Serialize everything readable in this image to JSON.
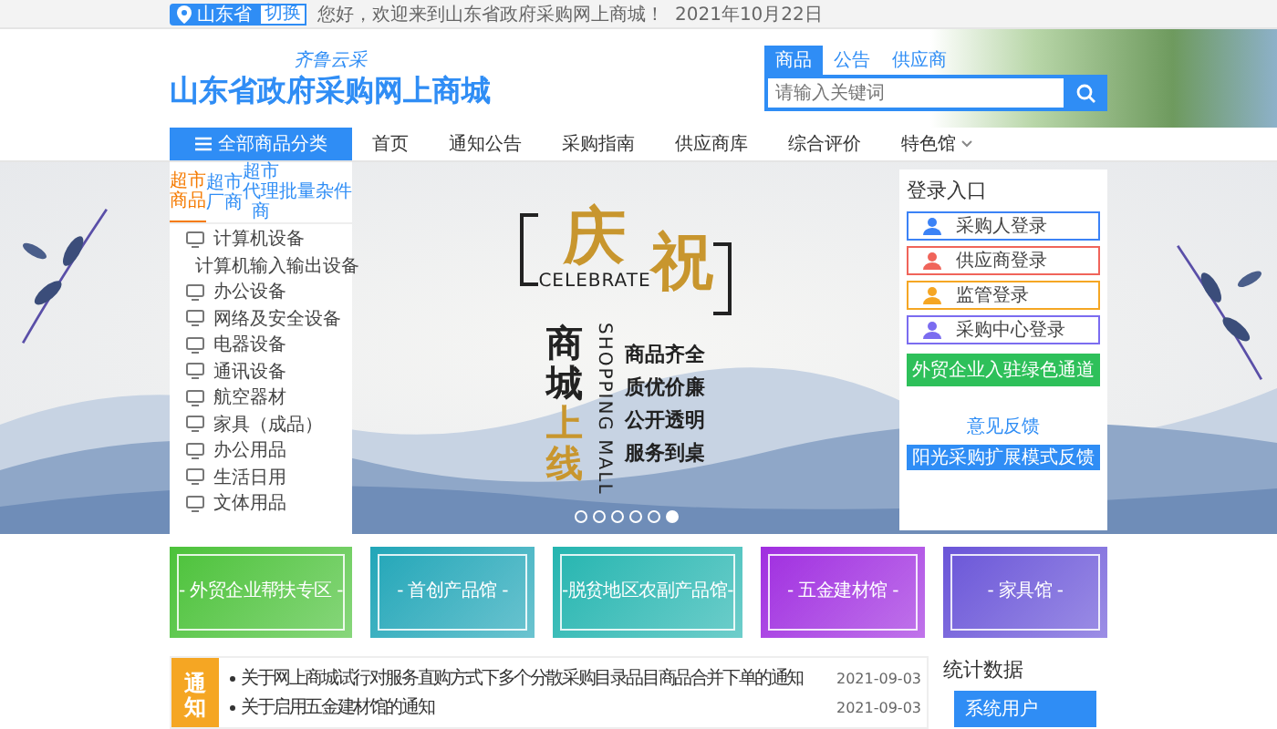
{
  "top_bar": {
    "location": "山东省",
    "switch_label": "切换",
    "welcome": "您好，欢迎来到山东省政府采购网上商城！",
    "date": "2021年10月22日"
  },
  "header": {
    "slogan": "齐鲁云采",
    "site_title": "山东省政府采购网上商城",
    "search_tabs": [
      {
        "label": "商品",
        "selected": true
      },
      {
        "label": "公告",
        "selected": false
      },
      {
        "label": "供应商",
        "selected": false
      }
    ],
    "search": {
      "placeholder": "请输入关键词"
    }
  },
  "nav": {
    "category_button": "全部商品分类",
    "items": [
      {
        "label": "首页",
        "dropdown": false
      },
      {
        "label": "通知公告",
        "dropdown": false
      },
      {
        "label": "采购指南",
        "dropdown": false
      },
      {
        "label": "供应商库",
        "dropdown": false
      },
      {
        "label": "综合评价",
        "dropdown": false
      },
      {
        "label": "特色馆",
        "dropdown": true
      }
    ]
  },
  "sidebar": {
    "tabs": [
      {
        "label": "超市商品",
        "selected": true
      },
      {
        "label": "超市厂商",
        "selected": false
      },
      {
        "label": "超市代理商",
        "selected": false
      },
      {
        "label": "批量",
        "selected": false
      },
      {
        "label": "杂件",
        "selected": false
      }
    ],
    "items": [
      "计算机设备",
      "计算机输入输出设备",
      "办公设备",
      "网络及安全设备",
      "电器设备",
      "通讯设备",
      "航空器材",
      "家具（成品）",
      "办公用品",
      "生活日用",
      "文体用品"
    ]
  },
  "banner": {
    "headline_1": "庆",
    "headline_2": "祝",
    "celebrate": "CELEBRATE",
    "mall_top": "商城",
    "mall_bottom": "上线",
    "mall_en": "SHOPPING MALL",
    "slogans": [
      "商品齐全",
      "质优价廉",
      "公开透明",
      "服务到桌"
    ],
    "dots": [
      {
        "selected": false
      },
      {
        "selected": false
      },
      {
        "selected": false
      },
      {
        "selected": false
      },
      {
        "selected": false
      },
      {
        "selected": true
      }
    ]
  },
  "login": {
    "title": "登录入口",
    "buttons": [
      {
        "label": "采购人登录",
        "color": "#3b82f6"
      },
      {
        "label": "供应商登录",
        "color": "#f0645a"
      },
      {
        "label": "监管登录",
        "color": "#f5a623"
      },
      {
        "label": "采购中心登录",
        "color": "#7b6cf0"
      }
    ],
    "green_button": "外贸企业入驻绿色通道",
    "feedback": "意见反馈",
    "blue_button": "阳光采购扩展模式反馈"
  },
  "tiles": [
    {
      "label": "- 外贸企业帮扶专区 -",
      "color": "#4cc23a"
    },
    {
      "label": "- 首创产品馆 -",
      "color": "#22a6b8"
    },
    {
      "label": "-脱贫地区农副产品馆-",
      "color": "#25b5b0"
    },
    {
      "label": "- 五金建材馆 -",
      "color": "#a02ee0"
    },
    {
      "label": "- 家具馆 -",
      "color": "#6a55d8"
    }
  ],
  "notices": {
    "label": "通知",
    "items": [
      {
        "title": "关于网上商城试行对服务直购方式下多个分散采购目录品目商品合并下单的通知",
        "date": "2021-09-03"
      },
      {
        "title": "关于启用五金建材馆的通知",
        "date": "2021-09-03"
      }
    ]
  },
  "stats": {
    "title": "统计数据",
    "item": "系统用户"
  }
}
